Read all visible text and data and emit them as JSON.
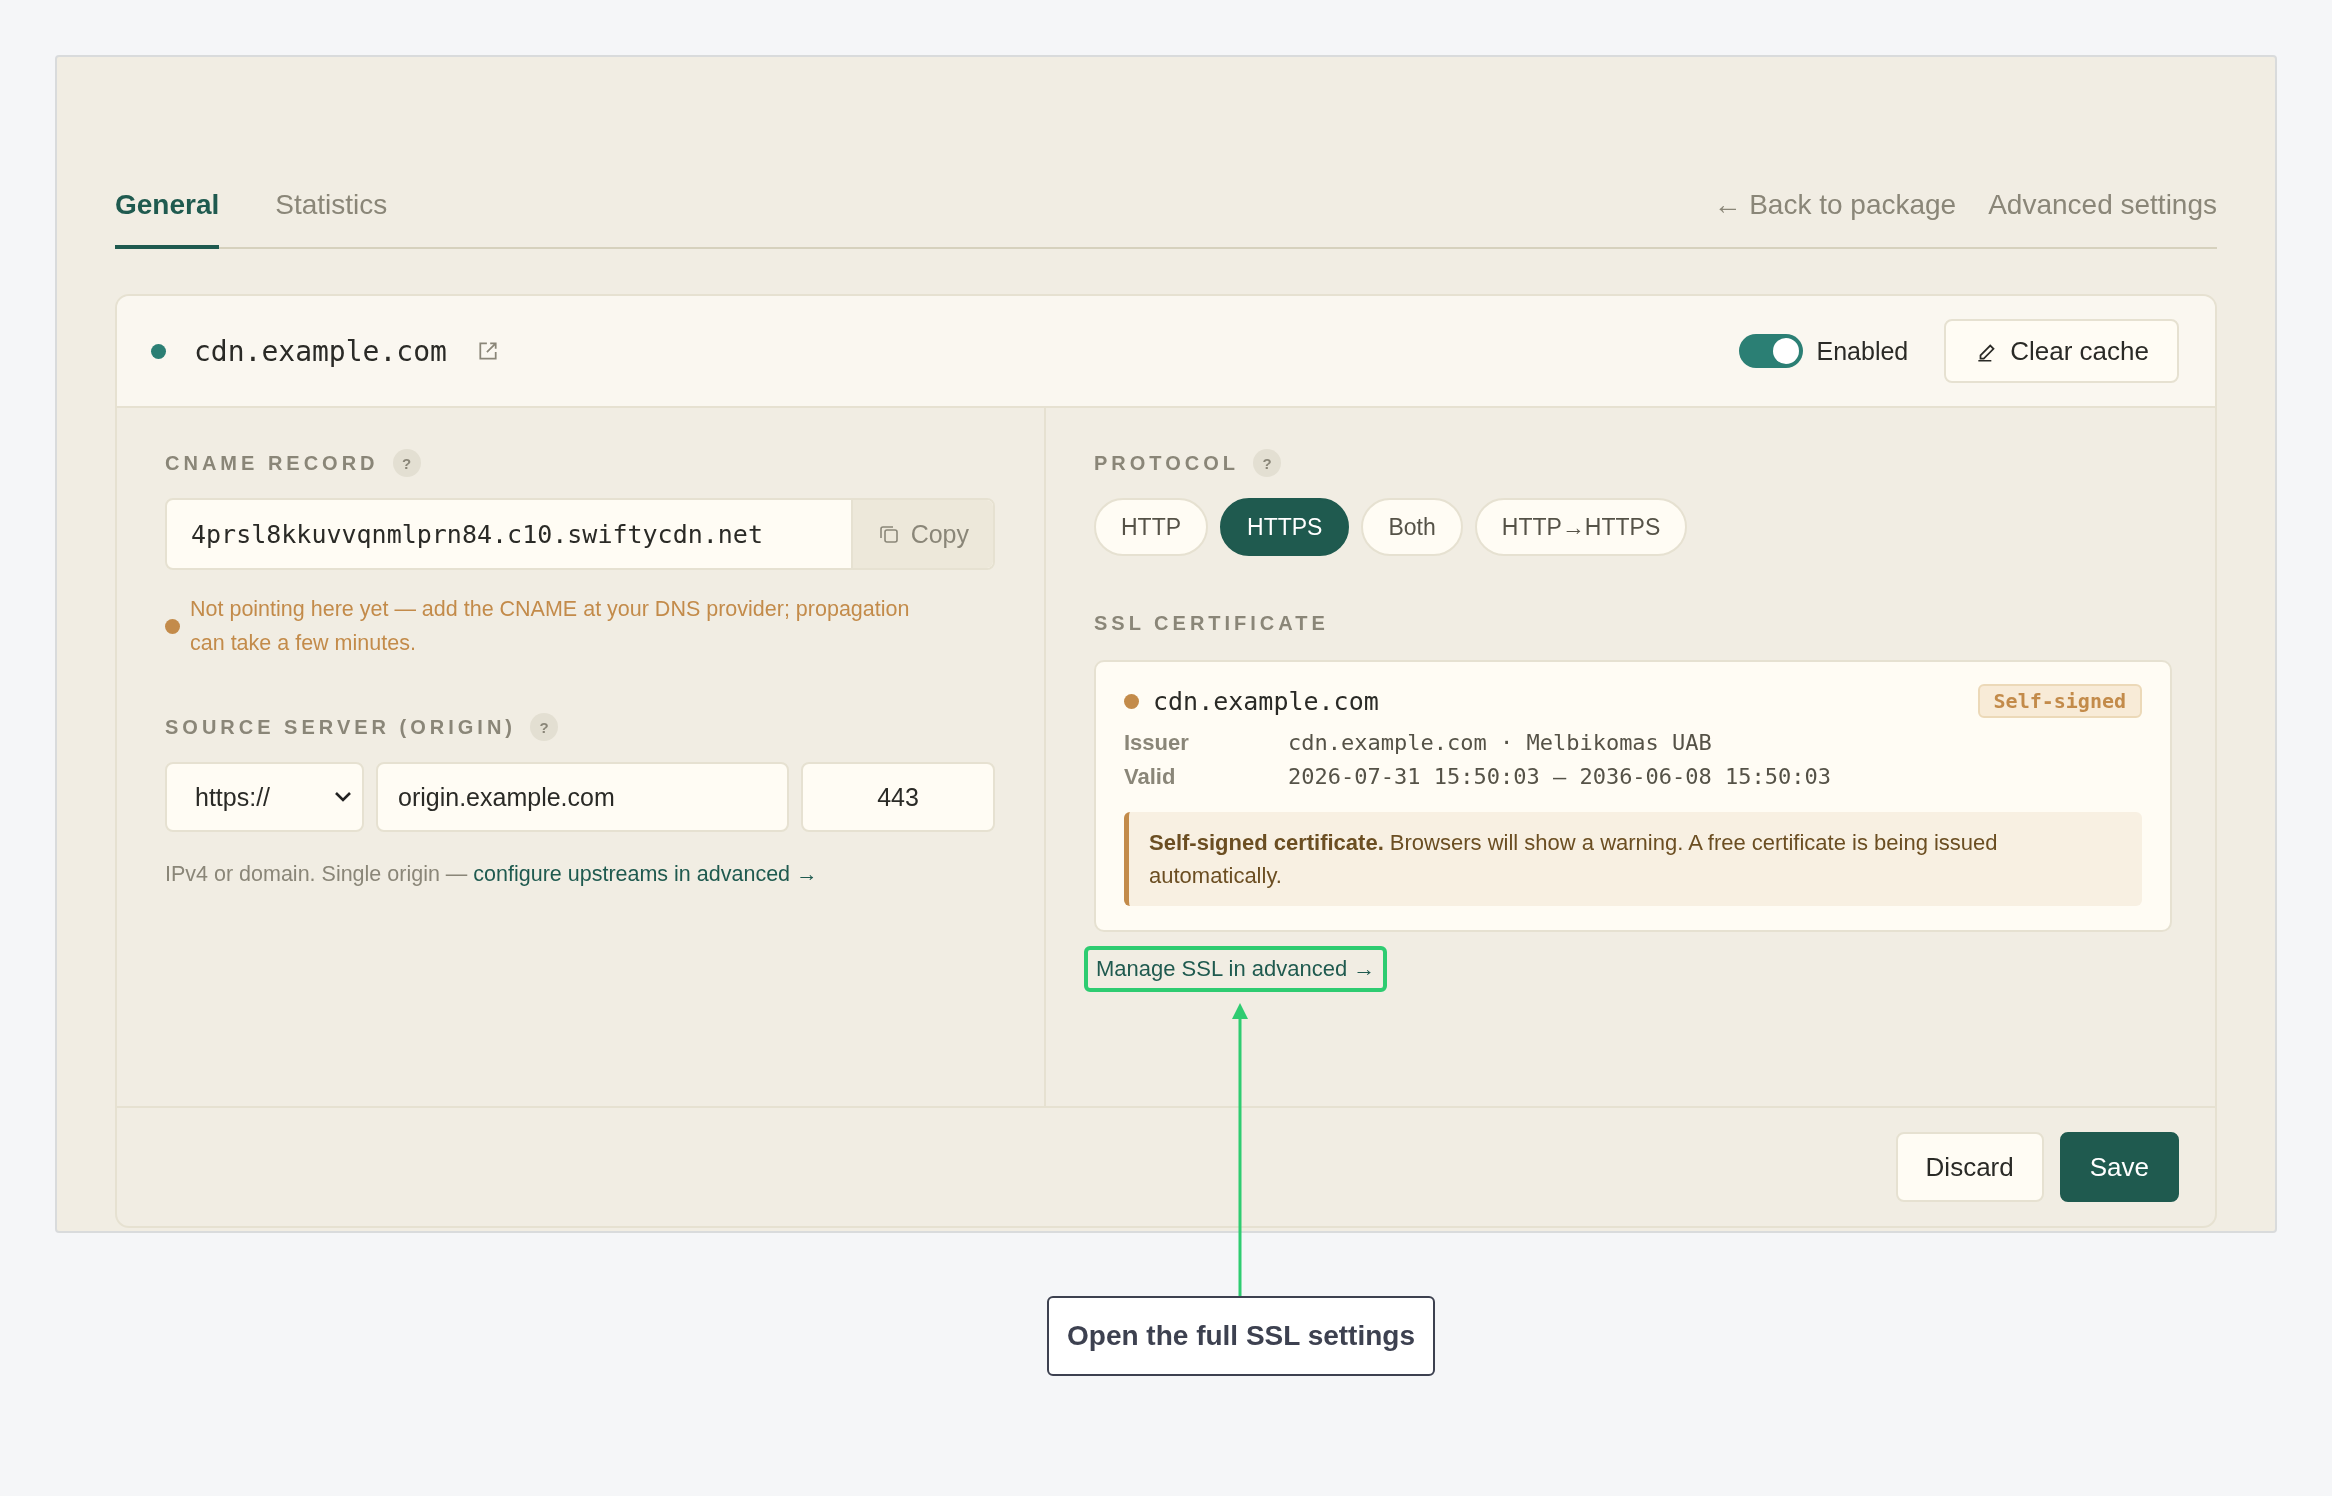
{
  "tabs": [
    {
      "label": "General",
      "selected": true
    },
    {
      "label": "Statistics",
      "selected": false
    }
  ],
  "header_links": [
    "← Back to package",
    "Advanced settings"
  ],
  "domain": {
    "name": "cdn.example.com",
    "enabled_label": "Enabled",
    "enabled": true,
    "clear_cache": "Clear cache"
  },
  "cname": {
    "label": "CNAME RECORD",
    "help": "?",
    "value": "4prsl8kkuvvqnmlprn84.c10.swiftycdn.net",
    "copy": "Copy",
    "warning": "Not pointing here yet — add the CNAME at your DNS provider; propagation can take a few minutes."
  },
  "origin": {
    "label": "SOURCE SERVER (ORIGIN)",
    "help": "?",
    "scheme": "https://",
    "host": "origin.example.com",
    "port": "443",
    "hint": "IPv4 or domain. Single origin — ",
    "hint_link": "configure upstreams in advanced →"
  },
  "protocol": {
    "label": "PROTOCOL",
    "help": "?",
    "options": [
      {
        "label": "HTTP",
        "selected": false
      },
      {
        "label": "HTTPS",
        "selected": true
      },
      {
        "label": "Both",
        "selected": false
      },
      {
        "label": "HTTP→HTTPS",
        "selected": false
      }
    ]
  },
  "ssl": {
    "label": "SSL CERTIFICATE",
    "domain": "cdn.example.com",
    "badge": "Self-signed",
    "fields": [
      {
        "label": "Issuer",
        "value": "cdn.example.com · Melbikomas UAB"
      },
      {
        "label": "Valid",
        "value": "2026-07-31 15:50:03 — 2036-06-08 15:50:03"
      }
    ],
    "notice": "**Self-signed certificate.** Browsers will show a warning. A free certificate is being issued automatically.",
    "manage_link": "Manage SSL in advanced →"
  },
  "buttons": [
    {
      "label": "Discard",
      "kind": "secondary"
    },
    {
      "label": "Save",
      "kind": "primary"
    }
  ],
  "annotation": "Open the full SSL settings"
}
